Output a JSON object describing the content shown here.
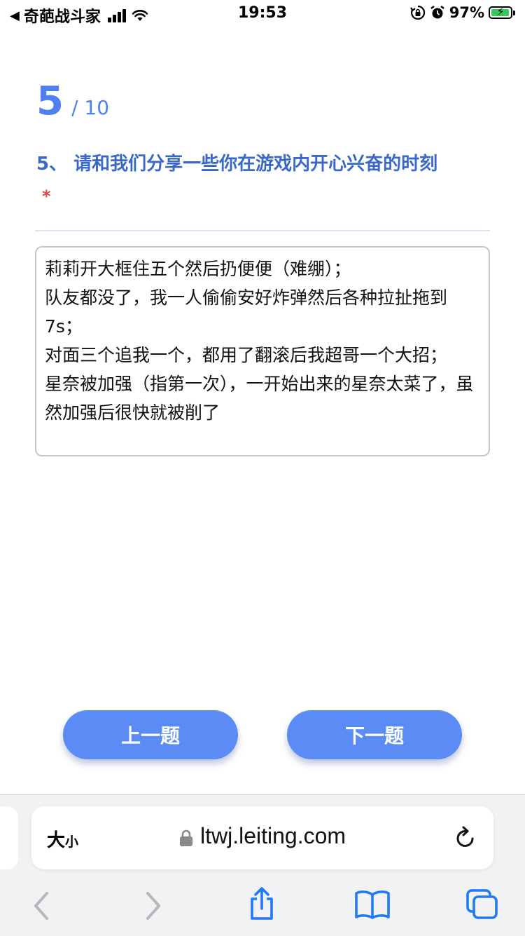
{
  "status_bar": {
    "back_label": "奇葩战斗家",
    "time": "19:53",
    "battery_percent": "97%",
    "battery_level": 0.97,
    "icons": [
      "back-arrow-icon",
      "signal-icon",
      "wifi-icon",
      "orientation-lock-icon",
      "alarm-icon",
      "battery-charging-icon"
    ]
  },
  "survey": {
    "progress_current": "5",
    "progress_total": "/ 10",
    "question_title": "5、 请和我们分享一些你在游戏内开心兴奋的时刻",
    "required_mark": "*",
    "answer_text": "莉莉开大框住五个然后扔便便（难绷）；\n队友都没了，我一人偷偷安好炸弹然后各种拉扯拖到7s；\n对面三个追我一个，都用了翻滚后我超哥一个大招；\n星奈被加强（指第一次），一开始出来的星奈太菜了，虽然加强后很快就被削了"
  },
  "buttons": {
    "prev_label": "上一题",
    "next_label": "下一题"
  },
  "browser": {
    "text_size_big": "大",
    "text_size_small": "小",
    "url": "ltwj.leiting.com",
    "toolbar_icons": [
      "back-icon",
      "forward-icon",
      "share-icon",
      "bookmarks-icon",
      "tabs-icon"
    ]
  },
  "colors": {
    "accent": "#4f7ff0",
    "title": "#3a68c8",
    "button": "#5b8cf5",
    "required": "#e04848",
    "ios_blue": "#1e7bf5"
  }
}
